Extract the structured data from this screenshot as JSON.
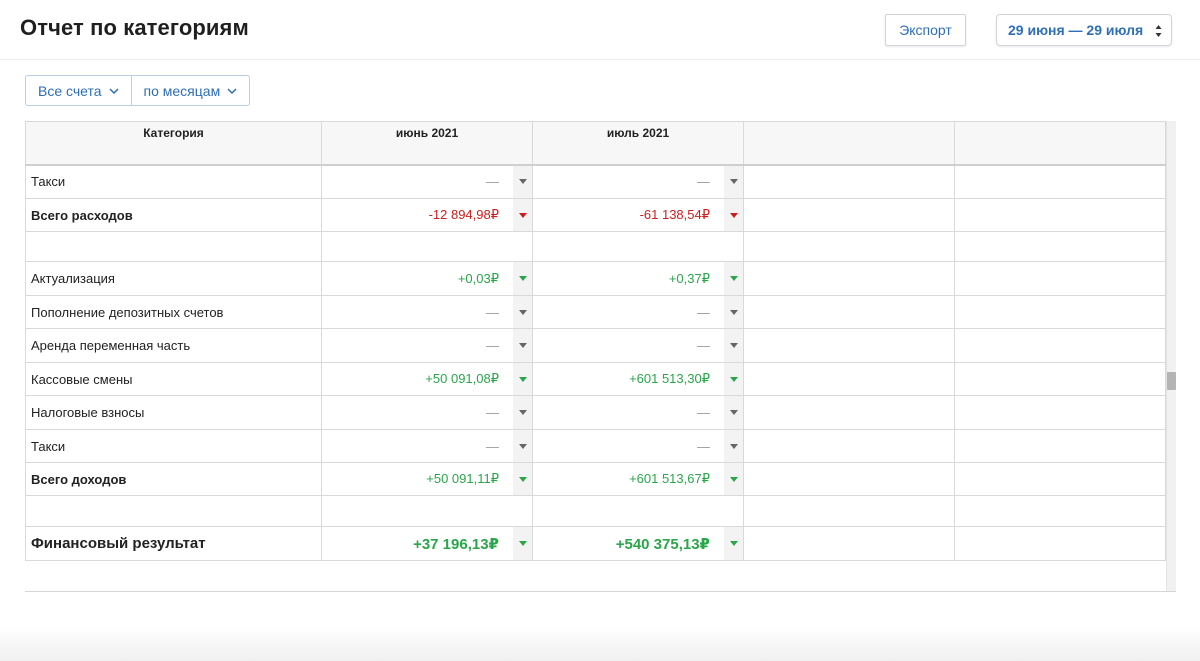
{
  "header": {
    "title": "Отчет по категориям",
    "export_label": "Экспорт",
    "date_range": "29 июня — 29 июля"
  },
  "filters": {
    "accounts": "Все счета",
    "grouping": "по месяцам"
  },
  "table": {
    "columns": [
      "Категория",
      "июнь 2021",
      "июль 2021",
      "",
      ""
    ],
    "rows": [
      {
        "category": "Такси",
        "june": "—",
        "july": "—",
        "kind": "neutral"
      },
      {
        "category": "Всего расходов",
        "june": "-12 894,98₽",
        "july": "-61 138,54₽",
        "kind": "neg",
        "bold": true
      },
      {
        "category": "",
        "june": "",
        "july": "",
        "kind": "spacer"
      },
      {
        "category": "Актуализация",
        "june": "+0,03₽",
        "july": "+0,37₽",
        "kind": "pos"
      },
      {
        "category": "Пополнение депозитных счетов",
        "june": "—",
        "july": "—",
        "kind": "neutral"
      },
      {
        "category": "Аренда переменная часть",
        "june": "—",
        "july": "—",
        "kind": "neutral"
      },
      {
        "category": "Кассовые смены",
        "june": "+50 091,08₽",
        "july": "+601 513,30₽",
        "kind": "pos"
      },
      {
        "category": "Налоговые взносы",
        "june": "—",
        "july": "—",
        "kind": "neutral"
      },
      {
        "category": "Такси",
        "june": "—",
        "july": "—",
        "kind": "neutral"
      },
      {
        "category": "Всего доходов",
        "june": "+50 091,11₽",
        "july": "+601 513,67₽",
        "kind": "pos",
        "bold": true
      },
      {
        "category": "",
        "june": "",
        "july": "",
        "kind": "spacer"
      },
      {
        "category": "Финансовый результат",
        "june": "+37 196,13₽",
        "july": "+540 375,13₽",
        "kind": "pos",
        "total": true
      }
    ]
  },
  "colors": {
    "accent": "#2e6fb5",
    "positive": "#2aa64a",
    "negative": "#cc1e1e",
    "neutral": "#999999"
  }
}
